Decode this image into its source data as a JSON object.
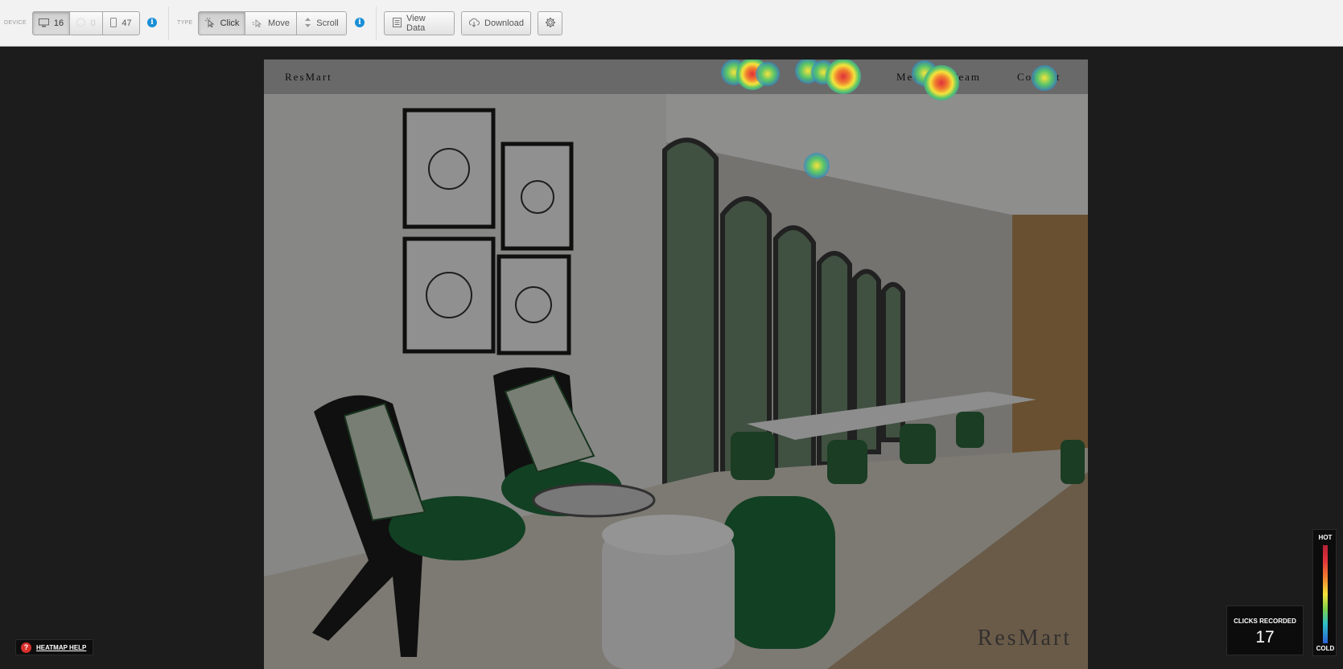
{
  "toolbar": {
    "device_label": "DEVICE",
    "type_label": "TYPE",
    "device_buttons": [
      {
        "icon": "desktop-icon",
        "count": "16"
      },
      {
        "icon": "tablet-icon",
        "count": "0"
      },
      {
        "icon": "mobile-icon",
        "count": "47"
      }
    ],
    "type_buttons": [
      {
        "icon": "click-icon",
        "label": "Click"
      },
      {
        "icon": "move-icon",
        "label": "Move"
      },
      {
        "icon": "scroll-icon",
        "label": "Scroll"
      }
    ],
    "info_glyph": "i",
    "view_data_label": "View Data",
    "download_label": "Download"
  },
  "site": {
    "brand": "ResMart",
    "nav": [
      "Menu",
      "Details",
      "Meet our Team",
      "Contact"
    ],
    "watermark": "ResMart"
  },
  "heatmap": {
    "help_label": "HEATMAP HELP",
    "clicks_label": "CLICKS RECORDED",
    "clicks_count": "17",
    "legend_hot": "HOT",
    "legend_cold": "COLD"
  },
  "colors": {
    "toolbar_bg": "#f2f2f2",
    "page_bg": "#1c1c1c",
    "info_blue": "#1b8fd6",
    "help_red": "#d9302b",
    "heat_hot": "#e0313c",
    "heat_cold": "#2a62d8"
  }
}
